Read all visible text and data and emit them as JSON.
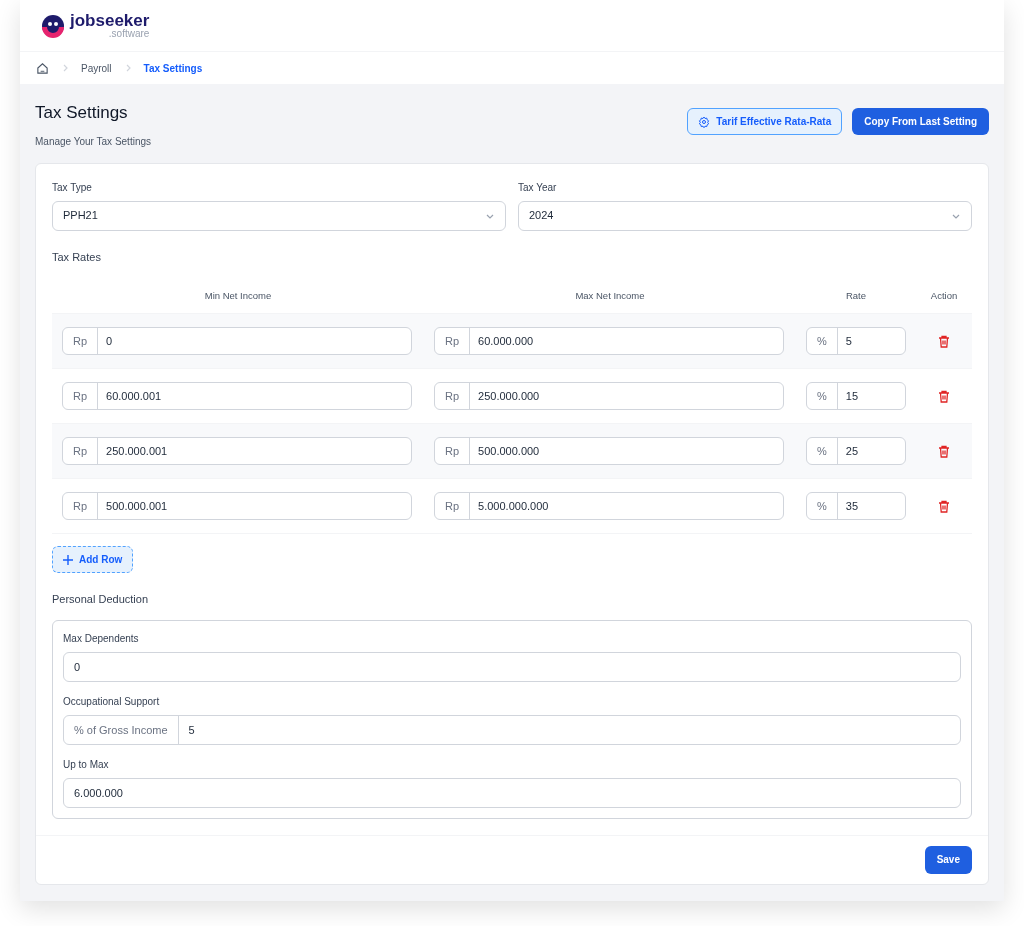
{
  "brand": {
    "name": "jobseeker",
    "suffix": ".software"
  },
  "breadcrumb": [
    {
      "label": "Payroll",
      "selected": false
    },
    {
      "label": "Tax Settings",
      "selected": true
    }
  ],
  "page": {
    "title": "Tax Settings",
    "subtitle": "Manage Your Tax Settings"
  },
  "actions": [
    {
      "label": "Tarif Effective Rata-Rata",
      "kind": "outline"
    },
    {
      "label": "Copy From Last Setting",
      "kind": "primary"
    }
  ],
  "tax_type": {
    "label": "Tax Type",
    "value": "PPH21"
  },
  "tax_year": {
    "label": "Tax Year",
    "value": "2024"
  },
  "tax_rates": {
    "title": "Tax Rates",
    "columns": [
      "Min Net Income",
      "Max Net Income",
      "Rate",
      "Action"
    ],
    "rows": [
      {
        "currency_min": "Rp",
        "min": "0",
        "currency_max": "Rp",
        "max": "60.000.000",
        "unit": "%",
        "rate": "5"
      },
      {
        "currency_min": "Rp",
        "min": "60.000.001",
        "currency_max": "Rp",
        "max": "250.000.000",
        "unit": "%",
        "rate": "15"
      },
      {
        "currency_min": "Rp",
        "min": "250.000.001",
        "currency_max": "Rp",
        "max": "500.000.000",
        "unit": "%",
        "rate": "25"
      },
      {
        "currency_min": "Rp",
        "min": "500.000.001",
        "currency_max": "Rp",
        "max": "5.000.000.000",
        "unit": "%",
        "rate": "35"
      }
    ],
    "add_button": "Add Row"
  },
  "personal_deduction": {
    "title": "Personal Deduction",
    "fields": [
      {
        "label": "Max Dependents",
        "value": "0"
      },
      {
        "label": "Occupational Support",
        "prefix": "% of Gross Income",
        "value": "5"
      },
      {
        "label": "Up to Max",
        "value": "6.000.000"
      }
    ]
  },
  "save_button": "Save"
}
